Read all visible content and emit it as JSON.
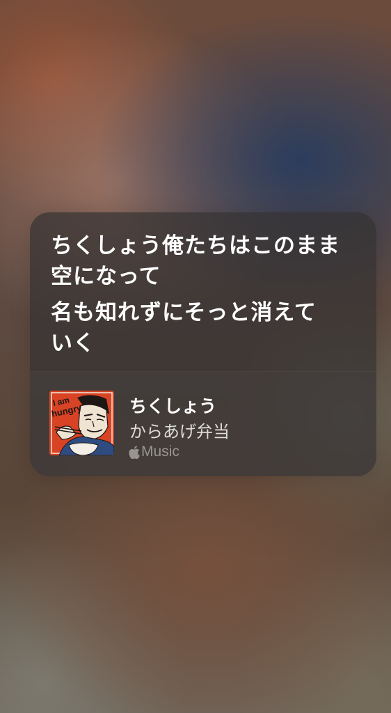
{
  "lyrics": {
    "lines": [
      "ちくしょう俺たちはこのまま",
      "空になって",
      "名も知れずにそっと消えて",
      "いく"
    ]
  },
  "track": {
    "title": "ちくしょう",
    "artist": "からあげ弁当",
    "service_label": "Music",
    "service_icon": "apple-logo-icon",
    "artwork_text": [
      "I am",
      "hungry"
    ]
  },
  "colors": {
    "card_bg": "#343232",
    "artwork_bg": "#d74324",
    "text_primary": "#ffffff",
    "text_secondary": "#d1cfcf",
    "text_tertiary": "#8c8785"
  }
}
